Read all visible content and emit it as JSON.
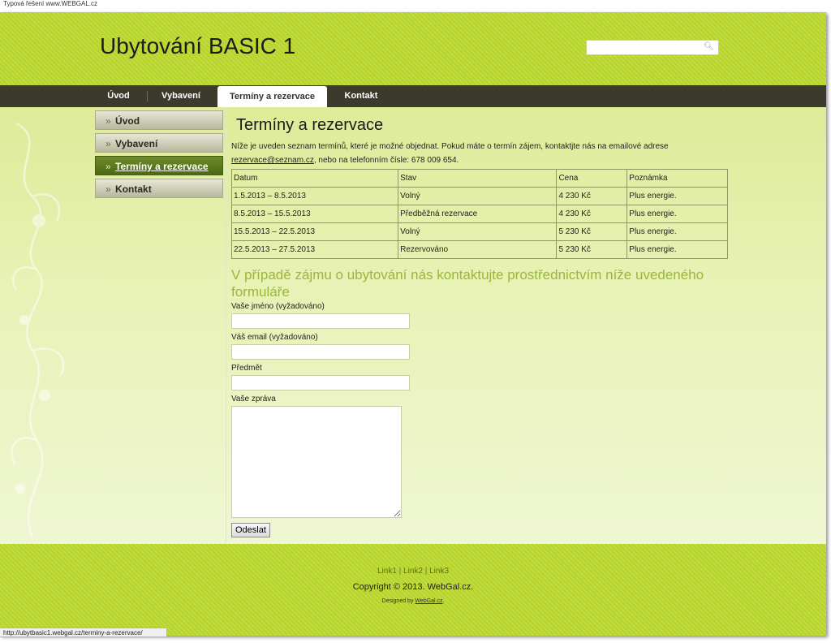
{
  "caption": "Typová řešení www.WEBGAL.cz",
  "header": {
    "site_title": "Ubytování BASIC 1",
    "search_placeholder": ""
  },
  "nav": {
    "items": [
      {
        "label": "Úvod"
      },
      {
        "label": "Vybavení"
      },
      {
        "label": "Termíny a rezervace",
        "active": true
      },
      {
        "label": "Kontakt"
      }
    ]
  },
  "sidebar": {
    "items": [
      {
        "label": "Úvod"
      },
      {
        "label": "Vybavení"
      },
      {
        "label": "Termíny a rezervace",
        "active": true
      },
      {
        "label": "Kontakt"
      }
    ]
  },
  "main": {
    "title": "Termíny a rezervace",
    "intro_text": "Níže je uveden seznam termínů, které je možné objednat. Pokud máte o termín zájem, kontaktjte nás na emailové adrese",
    "email": "rezervace@seznam.cz",
    "intro_suffix": ", nebo na telefonním čísle: 678 009 654.",
    "table": {
      "headers": [
        "Datum",
        "Stav",
        "Cena",
        "Poznámka"
      ],
      "rows": [
        [
          "1.5.2013 – 8.5.2013",
          "Volný",
          "4 230 Kč",
          "Plus energie."
        ],
        [
          "8.5.2013 – 15.5.2013",
          "Předběžná rezervace",
          "4 230 Kč",
          "Plus energie."
        ],
        [
          "15.5.2013 – 22.5.2013",
          "Volný",
          "5 230 Kč",
          "Plus energie."
        ],
        [
          "22.5.2013 – 27.5.2013",
          "Rezervováno",
          "5 230 Kč",
          "Plus energie."
        ]
      ]
    },
    "form_heading": "V případě zájmu o ubytování nás kontaktujte prostřednictvím níže uvedeného formuláře",
    "form": {
      "name_label": "Vaše jméno (vyžadováno)",
      "email_label": "Váš email (vyžadováno)",
      "subject_label": "Předmět",
      "message_label": "Vaše zpráva",
      "submit_label": "Odeslat"
    }
  },
  "footer": {
    "link1": "Link1",
    "link2": "Link2",
    "link3": "Link3",
    "copyright": "Copyright © 2013. WebGal.cz.",
    "designed_by": "Designed by",
    "designed_link": "WebGal.cz",
    "designed_suffix": "."
  },
  "statusbar": {
    "url": "http://ubytbasic1.webgal.cz/terminy-a-rezervace/"
  },
  "colors": {
    "header_green": "#bcd92e",
    "nav_dark": "#3b3a2c",
    "heading_green": "#9ab73a",
    "active_sidebar": "#4c6a14"
  }
}
